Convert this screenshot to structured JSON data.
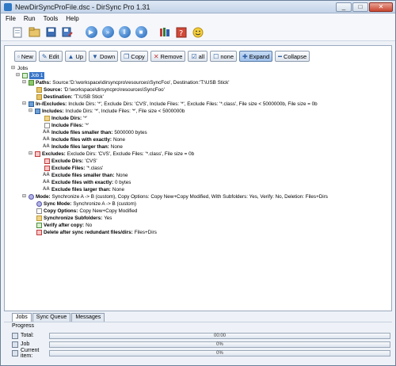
{
  "window": {
    "title": "NewDirSyncProFile.dsc - DirSync Pro 1.31",
    "min": "_",
    "max": "□",
    "close": "✕"
  },
  "menu": [
    "File",
    "Run",
    "Tools",
    "Help"
  ],
  "toolbar": {
    "icons": [
      {
        "name": "new-file-icon",
        "glyph": "▫"
      },
      {
        "name": "open-folder-icon",
        "glyph": "▬"
      },
      {
        "name": "save-icon",
        "glyph": "▪"
      },
      {
        "name": "save-as-icon",
        "glyph": "▣"
      },
      {
        "name": "run-icon",
        "glyph": "▶"
      },
      {
        "name": "run-all-icon",
        "glyph": "»"
      },
      {
        "name": "pause-icon",
        "glyph": "Ⅱ"
      },
      {
        "name": "stop-icon",
        "glyph": "■"
      },
      {
        "name": "books-icon",
        "glyph": "▤"
      },
      {
        "name": "help-icon",
        "glyph": "?"
      },
      {
        "name": "smiley-icon",
        "glyph": "☺"
      }
    ]
  },
  "job_toolbar": {
    "new": "New",
    "edit": "Edit",
    "up": "Up",
    "down": "Down",
    "copy": "Copy",
    "remove": "Remove",
    "all": "all",
    "none": "none",
    "expand": "Expand",
    "collapse": "Collapse"
  },
  "tree": {
    "root": "Jobs",
    "job": "Job 1",
    "paths": {
      "label": "Paths:",
      "value": "Source:'D:\\workspace\\dirsyncpro\\resources\\SyncFoo', Destination:'T:\\USB Stick'"
    },
    "source": {
      "label": "Source:",
      "value": "'D:\\workspace\\dirsyncpro\\resources\\SyncFoo'"
    },
    "destination": {
      "label": "Destination:",
      "value": "'T:\\USB Stick'"
    },
    "inex": {
      "label": "In-/Excludes:",
      "value": "Include Dirs: '*', Exclude Dirs: 'CVS', Include Files: '*', Exclude Files: '*.class', File size < 5000000b, File size = 0b"
    },
    "includes": {
      "label": "Includes:",
      "value": "Include Dirs: '*', Include Files: '*', File size < 5000000b"
    },
    "include_dirs": {
      "label": "Include Dirs:",
      "value": "'*'"
    },
    "include_files": {
      "label": "Include Files:",
      "value": "'*'"
    },
    "include_smaller": {
      "label": "Include files smaller than:",
      "value": "5000000 bytes"
    },
    "include_exactly": {
      "label": "Include files with exactly:",
      "value": "None"
    },
    "include_larger": {
      "label": "Include files larger than:",
      "value": "None"
    },
    "excludes": {
      "label": "Excludes:",
      "value": "Exclude Dirs: 'CVS', Exclude Files: '*.class', File size = 0b"
    },
    "exclude_dirs": {
      "label": "Exclude Dirs:",
      "value": "'CVS'"
    },
    "exclude_files": {
      "label": "Exclude Files:",
      "value": "'*.class'"
    },
    "exclude_smaller": {
      "label": "Exclude files smaller than:",
      "value": "None"
    },
    "exclude_exactly": {
      "label": "Exclude files with exactly:",
      "value": "0 bytes"
    },
    "exclude_larger": {
      "label": "Exclude files larger than:",
      "value": "None"
    },
    "mode": {
      "label": "Mode:",
      "value": "Synchronize A -> B (custom), Copy Options: Copy New+Copy Modified, With Subfolders: Yes, Verify: No, Deletion: Files+Dirs"
    },
    "sync_mode": {
      "label": "Sync Mode:",
      "value": "Synchronize A -> B (custom)"
    },
    "copy_options": {
      "label": "Copy Options:",
      "value": "Copy New+Copy Modified"
    },
    "subfolders": {
      "label": "Synchronize Subfolders:",
      "value": "Yes"
    },
    "verify": {
      "label": "Verify after copy:",
      "value": "No"
    },
    "delete": {
      "label": "Delete after sync redundant files/dirs:",
      "value": "Files+Dirs"
    }
  },
  "tabs": [
    "Jobs",
    "Sync Queue",
    "Messages"
  ],
  "progress": {
    "label": "Progress",
    "total": {
      "name": "Total:",
      "text": "00:00",
      "fraction": 0
    },
    "job": {
      "name": "Job",
      "text": "0%",
      "fraction": 0
    },
    "current": {
      "name": "Current item:",
      "text": "0%",
      "fraction": 0
    }
  }
}
